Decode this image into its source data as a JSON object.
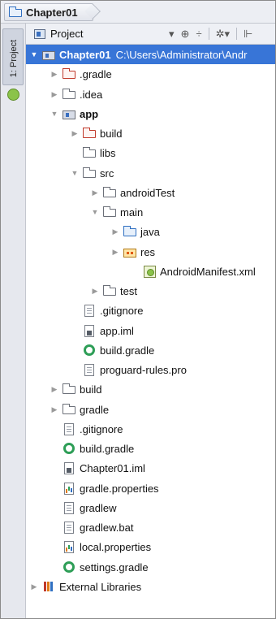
{
  "breadcrumb": {
    "project": "Chapter01"
  },
  "toolstrip": {
    "tab_label": "1: Project"
  },
  "panel": {
    "title": "Project",
    "tools": [
      "▾",
      "⊕",
      "÷",
      "✲▾",
      "⊩"
    ]
  },
  "tree": [
    {
      "depth": 0,
      "arrow": "▼",
      "icon": "module",
      "label": "Chapter01",
      "path": "C:\\Users\\Administrator\\Andr",
      "selected": true,
      "bold": true
    },
    {
      "depth": 1,
      "arrow": "▶",
      "icon": "folder-red",
      "label": ".gradle"
    },
    {
      "depth": 1,
      "arrow": "▶",
      "icon": "folder",
      "label": ".idea"
    },
    {
      "depth": 1,
      "arrow": "▼",
      "icon": "module",
      "label": "app",
      "bold": true
    },
    {
      "depth": 2,
      "arrow": "▶",
      "icon": "folder-red",
      "label": "build"
    },
    {
      "depth": 2,
      "arrow": "",
      "icon": "folder",
      "label": "libs"
    },
    {
      "depth": 2,
      "arrow": "▼",
      "icon": "folder",
      "label": "src"
    },
    {
      "depth": 3,
      "arrow": "▶",
      "icon": "folder",
      "label": "androidTest"
    },
    {
      "depth": 3,
      "arrow": "▼",
      "icon": "folder",
      "label": "main"
    },
    {
      "depth": 4,
      "arrow": "▶",
      "icon": "folder-blue",
      "label": "java"
    },
    {
      "depth": 4,
      "arrow": "▶",
      "icon": "res-folder",
      "label": "res"
    },
    {
      "depth": 5,
      "arrow": "",
      "icon": "manifest",
      "label": "AndroidManifest.xml"
    },
    {
      "depth": 3,
      "arrow": "▶",
      "icon": "folder",
      "label": "test"
    },
    {
      "depth": 2,
      "arrow": "",
      "icon": "doc",
      "label": ".gitignore"
    },
    {
      "depth": 2,
      "arrow": "",
      "icon": "iml",
      "label": "app.iml"
    },
    {
      "depth": 2,
      "arrow": "",
      "icon": "gradle",
      "label": "build.gradle"
    },
    {
      "depth": 2,
      "arrow": "",
      "icon": "doc",
      "label": "proguard-rules.pro"
    },
    {
      "depth": 1,
      "arrow": "▶",
      "icon": "folder",
      "label": "build"
    },
    {
      "depth": 1,
      "arrow": "▶",
      "icon": "folder",
      "label": "gradle"
    },
    {
      "depth": 1,
      "arrow": "",
      "icon": "doc",
      "label": ".gitignore"
    },
    {
      "depth": 1,
      "arrow": "",
      "icon": "gradle",
      "label": "build.gradle"
    },
    {
      "depth": 1,
      "arrow": "",
      "icon": "iml",
      "label": "Chapter01.iml"
    },
    {
      "depth": 1,
      "arrow": "",
      "icon": "props",
      "label": "gradle.properties"
    },
    {
      "depth": 1,
      "arrow": "",
      "icon": "doc",
      "label": "gradlew"
    },
    {
      "depth": 1,
      "arrow": "",
      "icon": "doc",
      "label": "gradlew.bat"
    },
    {
      "depth": 1,
      "arrow": "",
      "icon": "props",
      "label": "local.properties"
    },
    {
      "depth": 1,
      "arrow": "",
      "icon": "gradle",
      "label": "settings.gradle"
    },
    {
      "depth": 0,
      "arrow": "▶",
      "icon": "libraries",
      "label": "External Libraries"
    }
  ]
}
